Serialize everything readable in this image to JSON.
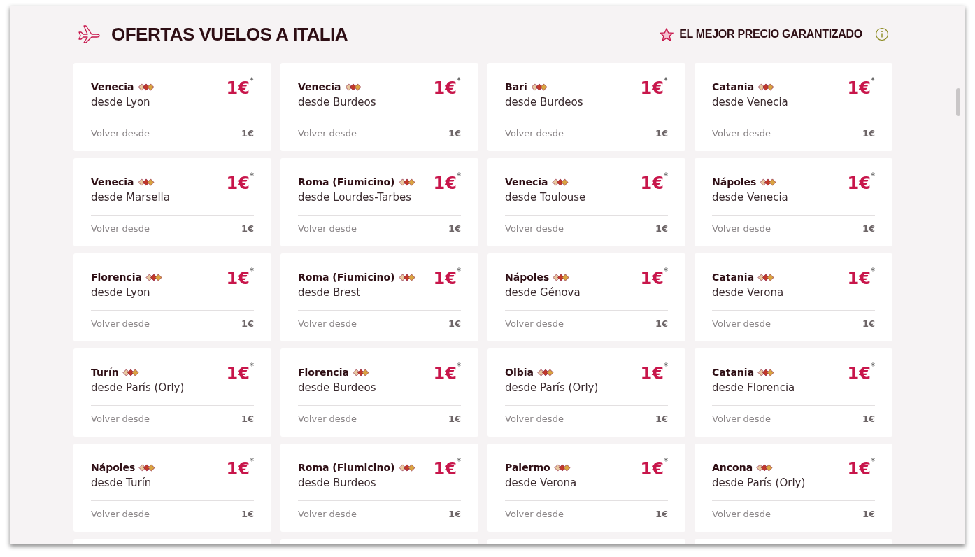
{
  "header": {
    "title": "OFERTAS VUELOS A ITALIA",
    "guarantee": "EL MEJOR PRECIO GARANTIZADO"
  },
  "offers": [
    {
      "destination": "Venecia",
      "origin": "desde Lyon",
      "price": "1€$^{*}$",
      "return_label": "Volver desde",
      "return_price": "1€"
    },
    {
      "destination": "Venecia",
      "origin": "desde Burdeos",
      "price": "1€$^{*}$",
      "return_label": "Volver desde",
      "return_price": "1€"
    },
    {
      "destination": "Bari",
      "origin": "desde Burdeos",
      "price": "1€$^{*}$",
      "return_label": "Volver desde",
      "return_price": "1€"
    },
    {
      "destination": "Catania",
      "origin": "desde Venecia",
      "price": "1€$^{*}$",
      "return_label": "Volver desde",
      "return_price": "1€"
    },
    {
      "destination": "Venecia",
      "origin": "desde Marsella",
      "price": "1€$^{*}$",
      "return_label": "Volver desde",
      "return_price": "1€"
    },
    {
      "destination": "Roma (Fiumicino)",
      "origin": "desde Lourdes-Tarbes",
      "price": "1€$^{*}$",
      "return_label": "Volver desde",
      "return_price": "1€"
    },
    {
      "destination": "Venecia",
      "origin": "desde Toulouse",
      "price": "1€$^{*}$",
      "return_label": "Volver desde",
      "return_price": "1€"
    },
    {
      "destination": "Nápoles",
      "origin": "desde Venecia",
      "price": "1€$^{*}$",
      "return_label": "Volver desde",
      "return_price": "1€"
    },
    {
      "destination": "Florencia",
      "origin": "desde Lyon",
      "price": "1€$^{*}$",
      "return_label": "Volver desde",
      "return_price": "1€"
    },
    {
      "destination": "Roma (Fiumicino)",
      "origin": "desde Brest",
      "price": "1€$^{*}$",
      "return_label": "Volver desde",
      "return_price": "1€"
    },
    {
      "destination": "Nápoles",
      "origin": "desde Génova",
      "price": "1€$^{*}$",
      "return_label": "Volver desde",
      "return_price": "1€"
    },
    {
      "destination": "Catania",
      "origin": "desde Verona",
      "price": "1€$^{*}$",
      "return_label": "Volver desde",
      "return_price": "1€"
    },
    {
      "destination": "Turín",
      "origin": "desde París (Orly)",
      "price": "1€$^{*}$",
      "return_label": "Volver desde",
      "return_price": "1€"
    },
    {
      "destination": "Florencia",
      "origin": "desde Burdeos",
      "price": "1€$^{*}$",
      "return_label": "Volver desde",
      "return_price": "1€"
    },
    {
      "destination": "Olbia",
      "origin": "desde París (Orly)",
      "price": "1€$^{*}$",
      "return_label": "Volver desde",
      "return_price": "1€"
    },
    {
      "destination": "Catania",
      "origin": "desde Florencia",
      "price": "1€$^{*}$",
      "return_label": "Volver desde",
      "return_price": "1€"
    },
    {
      "destination": "Nápoles",
      "origin": "desde Turín",
      "price": "1€$^{*}$",
      "return_label": "Volver desde",
      "return_price": "1€"
    },
    {
      "destination": "Roma (Fiumicino)",
      "origin": "desde Burdeos",
      "price": "1€$^{*}$",
      "return_label": "Volver desde",
      "return_price": "1€"
    },
    {
      "destination": "Palermo",
      "origin": "desde Verona",
      "price": "1€$^{*}$",
      "return_label": "Volver desde",
      "return_price": "1€"
    },
    {
      "destination": "Ancona",
      "origin": "desde París (Orly)",
      "price": "1€$^{*}$",
      "return_label": "Volver desde",
      "return_price": "1€"
    }
  ]
}
